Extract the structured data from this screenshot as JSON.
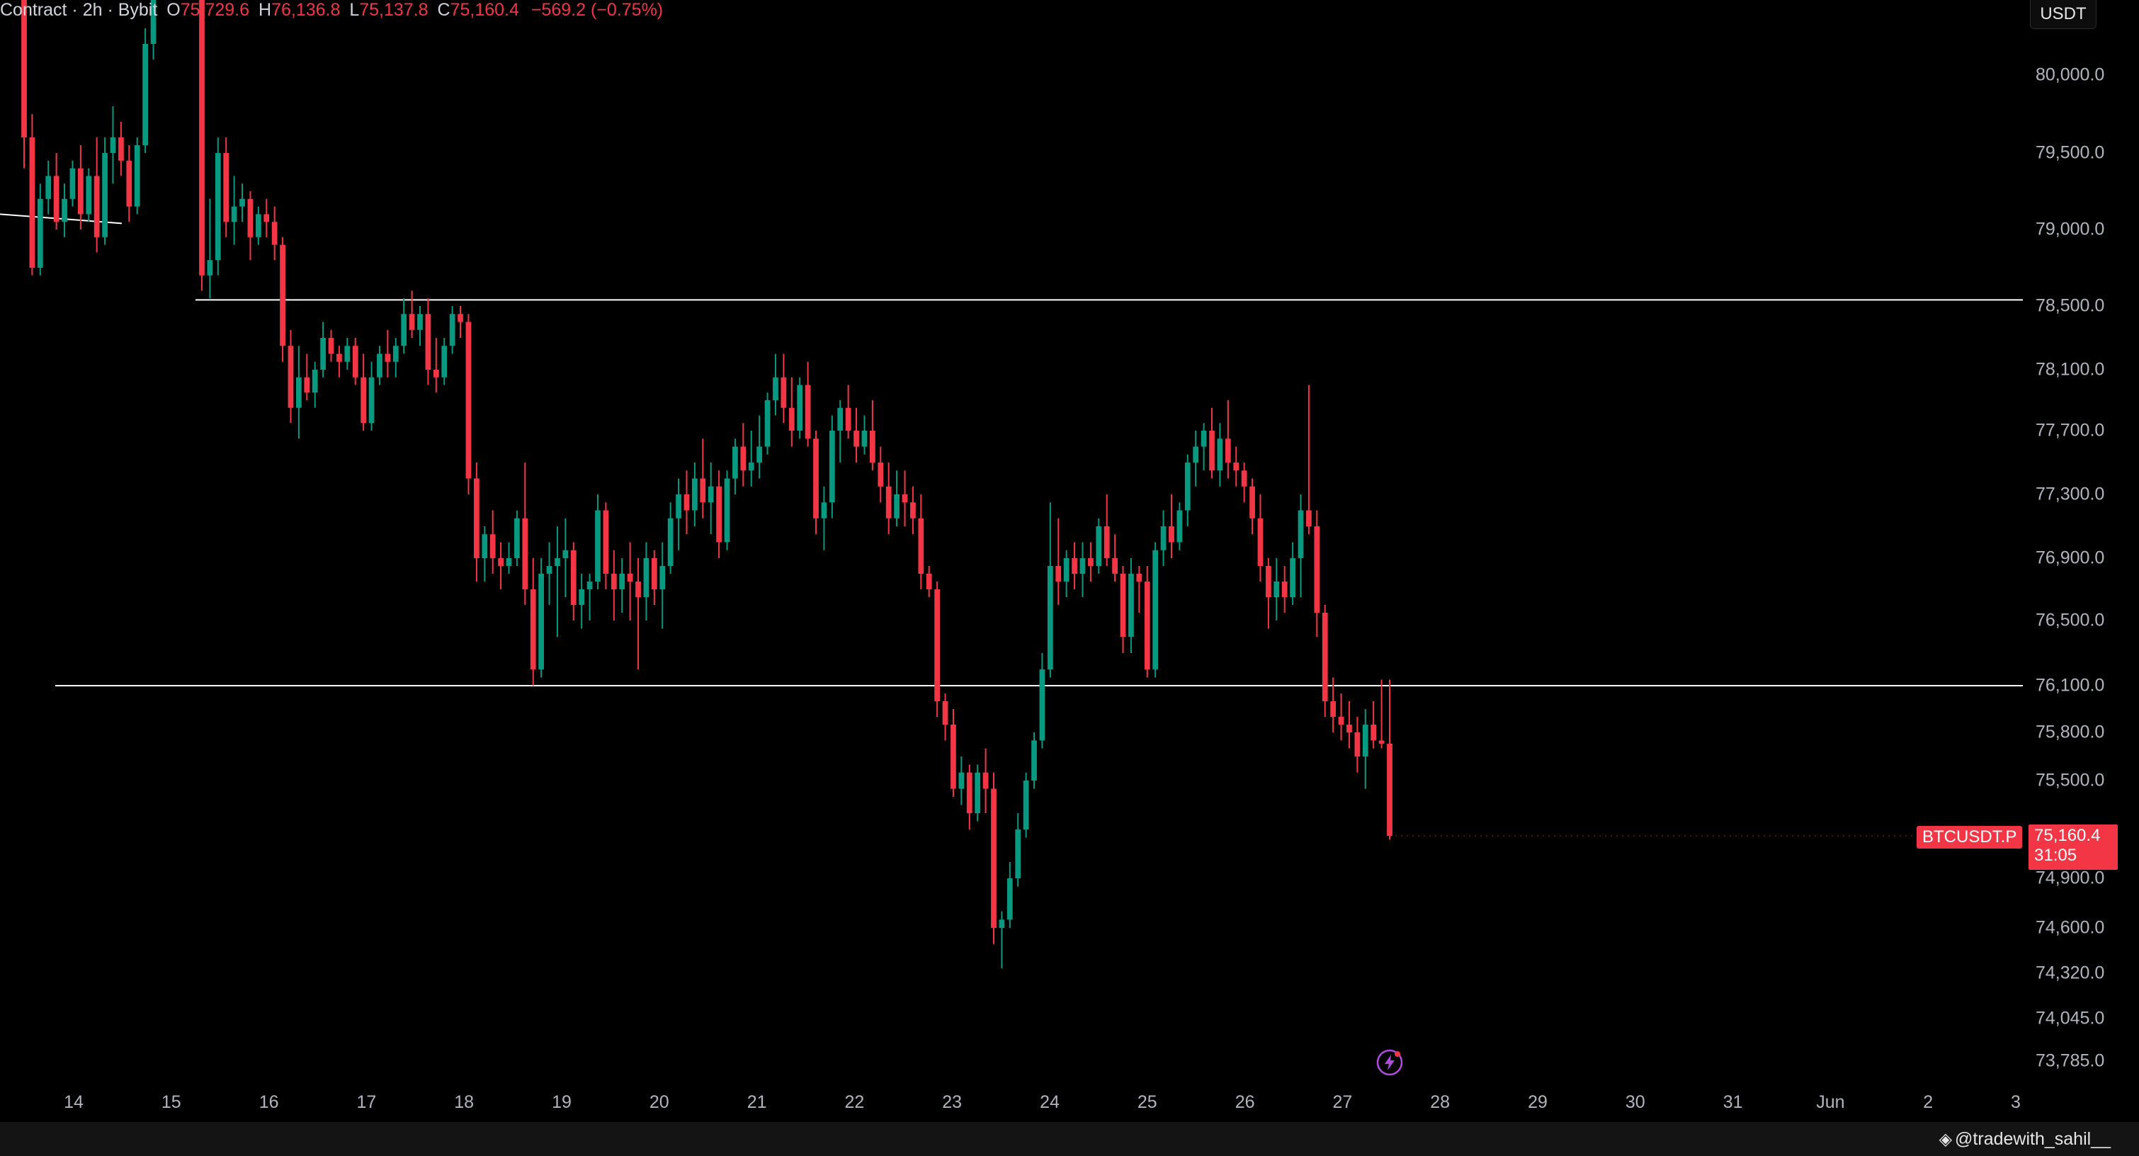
{
  "legend": {
    "symbol": "Contract · 2h · Bybit",
    "o_label": "O",
    "o_value": "75,729.6",
    "h_label": "H",
    "h_value": "76,136.8",
    "l_label": "L",
    "l_value": "75,137.8",
    "c_label": "C",
    "c_value": "75,160.4",
    "change": "−569.2 (−0.75%)"
  },
  "price_axis": {
    "unit": "USDT",
    "ticks": [
      "80,000.0",
      "79,500.0",
      "79,000.0",
      "78,500.0",
      "78,100.0",
      "77,700.0",
      "77,300.0",
      "76,900.0",
      "76,500.0",
      "76,100.0",
      "75,800.0",
      "75,500.0",
      "74,900.0",
      "74,600.0",
      "74,320.0",
      "74,045.0",
      "73,785.0"
    ]
  },
  "time_axis": {
    "ticks": [
      "14",
      "15",
      "16",
      "17",
      "18",
      "19",
      "20",
      "21",
      "22",
      "23",
      "24",
      "25",
      "26",
      "27",
      "28",
      "29",
      "30",
      "31",
      "Jun",
      "2",
      "3"
    ]
  },
  "current_price": {
    "symbol": "BTCUSDT.P",
    "price": "75,160.4",
    "countdown": "31:05"
  },
  "watermark": "@tradewith_sahil__",
  "colors": {
    "up": "#089981",
    "down": "#f23645",
    "background": "#000000",
    "line": "#ffffff"
  },
  "chart_data": {
    "type": "candlestick",
    "interval": "2h",
    "horizontal_lines": [
      78540,
      76100
    ],
    "trendline": [
      [
        79100,
        79040
      ]
    ],
    "candles": [
      [
        80600,
        81000,
        79400,
        79600
      ],
      [
        79600,
        79750,
        78700,
        78750
      ],
      [
        78750,
        79300,
        78700,
        79200
      ],
      [
        79200,
        79450,
        79100,
        79350
      ],
      [
        79350,
        79500,
        79000,
        79050
      ],
      [
        79050,
        79300,
        78950,
        79200
      ],
      [
        79200,
        79450,
        79150,
        79400
      ],
      [
        79400,
        79550,
        79000,
        79100
      ],
      [
        79100,
        79400,
        79050,
        79350
      ],
      [
        79350,
        79600,
        78850,
        78950
      ],
      [
        78950,
        79600,
        78900,
        79500
      ],
      [
        79500,
        79800,
        79300,
        79600
      ],
      [
        79600,
        79700,
        79350,
        79450
      ],
      [
        79450,
        79550,
        79050,
        79150
      ],
      [
        79150,
        79600,
        79100,
        79550
      ],
      [
        79550,
        80300,
        79500,
        80200
      ],
      [
        80200,
        81000,
        80100,
        80900
      ],
      [
        80900,
        81200,
        80500,
        80700
      ],
      [
        80700,
        81300,
        80600,
        81100
      ],
      [
        81100,
        81400,
        80700,
        80800
      ],
      [
        80800,
        81300,
        80700,
        81200
      ],
      [
        81200,
        81400,
        80600,
        80700
      ],
      [
        80700,
        80950,
        78600,
        78700
      ],
      [
        78700,
        79200,
        78550,
        78800
      ],
      [
        78800,
        79600,
        78700,
        79500
      ],
      [
        79500,
        79600,
        78950,
        79050
      ],
      [
        79050,
        79350,
        78900,
        79150
      ],
      [
        79150,
        79300,
        79050,
        79200
      ],
      [
        79200,
        79250,
        78800,
        78950
      ],
      [
        78950,
        79150,
        78900,
        79100
      ],
      [
        79100,
        79200,
        78950,
        79050
      ],
      [
        79050,
        79150,
        78800,
        78900
      ],
      [
        78900,
        78950,
        78150,
        78250
      ],
      [
        78250,
        78350,
        77750,
        77850
      ],
      [
        77850,
        78250,
        77650,
        78050
      ],
      [
        78050,
        78200,
        77900,
        77950
      ],
      [
        77950,
        78150,
        77850,
        78100
      ],
      [
        78100,
        78400,
        78050,
        78300
      ],
      [
        78300,
        78350,
        78150,
        78200
      ],
      [
        78200,
        78250,
        78050,
        78150
      ],
      [
        78150,
        78300,
        78100,
        78250
      ],
      [
        78250,
        78300,
        78000,
        78050
      ],
      [
        78050,
        78200,
        77700,
        77750
      ],
      [
        77750,
        78150,
        77700,
        78050
      ],
      [
        78050,
        78250,
        78000,
        78200
      ],
      [
        78200,
        78350,
        78050,
        78150
      ],
      [
        78150,
        78300,
        78050,
        78250
      ],
      [
        78250,
        78550,
        78200,
        78450
      ],
      [
        78450,
        78600,
        78300,
        78350
      ],
      [
        78350,
        78500,
        78250,
        78450
      ],
      [
        78450,
        78550,
        78000,
        78100
      ],
      [
        78100,
        78300,
        77950,
        78050
      ],
      [
        78050,
        78300,
        78000,
        78250
      ],
      [
        78250,
        78500,
        78200,
        78450
      ],
      [
        78450,
        78500,
        78300,
        78400
      ],
      [
        78400,
        78450,
        77300,
        77400
      ],
      [
        77400,
        77500,
        76750,
        76900
      ],
      [
        76900,
        77100,
        76750,
        77050
      ],
      [
        77050,
        77200,
        76800,
        76900
      ],
      [
        76900,
        77000,
        76700,
        76850
      ],
      [
        76850,
        77000,
        76800,
        76900
      ],
      [
        76900,
        77200,
        76850,
        77150
      ],
      [
        77150,
        77500,
        76600,
        76700
      ],
      [
        76700,
        76900,
        76100,
        76200
      ],
      [
        76200,
        76900,
        76150,
        76800
      ],
      [
        76800,
        77000,
        76600,
        76850
      ],
      [
        76850,
        77100,
        76400,
        76900
      ],
      [
        76900,
        77150,
        76650,
        76950
      ],
      [
        76950,
        77000,
        76500,
        76600
      ],
      [
        76600,
        76800,
        76450,
        76700
      ],
      [
        76700,
        76800,
        76500,
        76750
      ],
      [
        76750,
        77300,
        76700,
        77200
      ],
      [
        77200,
        77250,
        76700,
        76800
      ],
      [
        76800,
        76950,
        76500,
        76700
      ],
      [
        76700,
        76900,
        76550,
        76800
      ],
      [
        76800,
        77000,
        76500,
        76750
      ],
      [
        76750,
        76900,
        76200,
        76650
      ],
      [
        76650,
        77000,
        76500,
        76900
      ],
      [
        76900,
        76950,
        76600,
        76700
      ],
      [
        76700,
        77000,
        76450,
        76850
      ],
      [
        76850,
        77250,
        76800,
        77150
      ],
      [
        77150,
        77400,
        76950,
        77300
      ],
      [
        77300,
        77450,
        77050,
        77200
      ],
      [
        77200,
        77500,
        77100,
        77400
      ],
      [
        77400,
        77650,
        77150,
        77250
      ],
      [
        77250,
        77500,
        77050,
        77350
      ],
      [
        77350,
        77450,
        76900,
        77000
      ],
      [
        77000,
        77450,
        76950,
        77400
      ],
      [
        77400,
        77650,
        77300,
        77600
      ],
      [
        77600,
        77750,
        77350,
        77450
      ],
      [
        77450,
        77700,
        77350,
        77500
      ],
      [
        77500,
        77800,
        77400,
        77600
      ],
      [
        77600,
        77950,
        77550,
        77900
      ],
      [
        77900,
        78200,
        77800,
        78050
      ],
      [
        78050,
        78200,
        77750,
        77850
      ],
      [
        77850,
        78050,
        77600,
        77700
      ],
      [
        77700,
        78050,
        77650,
        78000
      ],
      [
        78000,
        78150,
        77600,
        77650
      ],
      [
        77650,
        77700,
        77050,
        77150
      ],
      [
        77150,
        77350,
        76950,
        77250
      ],
      [
        77250,
        77800,
        77150,
        77700
      ],
      [
        77700,
        77900,
        77500,
        77850
      ],
      [
        77850,
        78000,
        77650,
        77700
      ],
      [
        77700,
        77850,
        77500,
        77600
      ],
      [
        77600,
        77800,
        77550,
        77700
      ],
      [
        77700,
        77900,
        77450,
        77500
      ],
      [
        77500,
        77600,
        77250,
        77350
      ],
      [
        77350,
        77500,
        77050,
        77150
      ],
      [
        77150,
        77450,
        77100,
        77300
      ],
      [
        77300,
        77450,
        77100,
        77250
      ],
      [
        77250,
        77350,
        77050,
        77150
      ],
      [
        77150,
        77300,
        76700,
        76800
      ],
      [
        76800,
        76850,
        76650,
        76700
      ],
      [
        76700,
        76750,
        75900,
        76000
      ],
      [
        76000,
        76050,
        75750,
        75850
      ],
      [
        75850,
        75950,
        75400,
        75450
      ],
      [
        75450,
        75650,
        75350,
        75550
      ],
      [
        75550,
        75600,
        75200,
        75300
      ],
      [
        75300,
        75600,
        75250,
        75550
      ],
      [
        75550,
        75700,
        75300,
        75450
      ],
      [
        75450,
        75550,
        74500,
        74600
      ],
      [
        74600,
        74700,
        74350,
        74650
      ],
      [
        74650,
        75000,
        74600,
        74900
      ],
      [
        74900,
        75300,
        74850,
        75200
      ],
      [
        75200,
        75550,
        75150,
        75500
      ],
      [
        75500,
        75800,
        75450,
        75750
      ],
      [
        75750,
        76300,
        75700,
        76200
      ],
      [
        76200,
        77250,
        76150,
        76850
      ],
      [
        76850,
        77150,
        76600,
        76750
      ],
      [
        76750,
        76950,
        76650,
        76900
      ],
      [
        76900,
        77000,
        76700,
        76800
      ],
      [
        76800,
        77000,
        76650,
        76900
      ],
      [
        76900,
        77000,
        76750,
        76850
      ],
      [
        76850,
        77150,
        76800,
        77100
      ],
      [
        77100,
        77300,
        76850,
        76900
      ],
      [
        76900,
        77050,
        76750,
        76800
      ],
      [
        76800,
        76850,
        76300,
        76400
      ],
      [
        76400,
        76900,
        76300,
        76800
      ],
      [
        76800,
        76850,
        76550,
        76750
      ],
      [
        76750,
        76850,
        76150,
        76200
      ],
      [
        76200,
        77000,
        76150,
        76950
      ],
      [
        76950,
        77200,
        76850,
        77100
      ],
      [
        77100,
        77300,
        76900,
        77000
      ],
      [
        77000,
        77250,
        76950,
        77200
      ],
      [
        77200,
        77550,
        77100,
        77500
      ],
      [
        77500,
        77700,
        77350,
        77600
      ],
      [
        77600,
        77750,
        77450,
        77700
      ],
      [
        77700,
        77850,
        77400,
        77450
      ],
      [
        77450,
        77750,
        77350,
        77650
      ],
      [
        77650,
        77900,
        77400,
        77500
      ],
      [
        77500,
        77600,
        77350,
        77450
      ],
      [
        77450,
        77500,
        77250,
        77350
      ],
      [
        77350,
        77400,
        77050,
        77150
      ],
      [
        77150,
        77300,
        76750,
        76850
      ],
      [
        76850,
        76900,
        76450,
        76650
      ],
      [
        76650,
        76900,
        76500,
        76750
      ],
      [
        76750,
        76850,
        76550,
        76650
      ],
      [
        76650,
        77000,
        76600,
        76900
      ],
      [
        76900,
        77300,
        76650,
        77200
      ],
      [
        77200,
        78000,
        77050,
        77100
      ],
      [
        77100,
        77200,
        76400,
        76550
      ],
      [
        76550,
        76600,
        75900,
        76000
      ],
      [
        76000,
        76150,
        75800,
        75900
      ],
      [
        75900,
        76050,
        75750,
        75850
      ],
      [
        75850,
        76000,
        75700,
        75800
      ],
      [
        75800,
        75900,
        75550,
        75650
      ],
      [
        75650,
        75950,
        75450,
        75850
      ],
      [
        75850,
        76000,
        75700,
        75750
      ],
      [
        75750,
        76136.8,
        75700,
        75729.6
      ],
      [
        75729.6,
        76136.8,
        75137.8,
        75160.4
      ]
    ]
  }
}
